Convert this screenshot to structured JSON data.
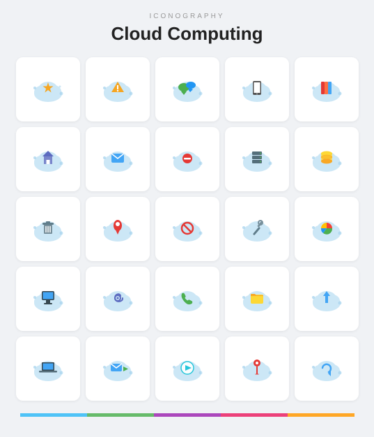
{
  "header": {
    "subtitle": "Iconography",
    "title": "Cloud Computing"
  },
  "icons": [
    {
      "name": "cloud-star",
      "desc": "Cloud with star"
    },
    {
      "name": "cloud-warning",
      "desc": "Cloud with warning"
    },
    {
      "name": "cloud-chat",
      "desc": "Cloud with chat"
    },
    {
      "name": "cloud-mobile",
      "desc": "Cloud with mobile"
    },
    {
      "name": "cloud-book",
      "desc": "Cloud with book"
    },
    {
      "name": "cloud-home",
      "desc": "Cloud with home"
    },
    {
      "name": "cloud-mail",
      "desc": "Cloud with mail"
    },
    {
      "name": "cloud-minus",
      "desc": "Cloud with minus"
    },
    {
      "name": "cloud-server",
      "desc": "Cloud with server"
    },
    {
      "name": "cloud-database",
      "desc": "Cloud with database"
    },
    {
      "name": "cloud-trash",
      "desc": "Cloud with trash"
    },
    {
      "name": "cloud-location",
      "desc": "Cloud with location"
    },
    {
      "name": "cloud-block",
      "desc": "Cloud with block"
    },
    {
      "name": "cloud-settings",
      "desc": "Cloud with settings"
    },
    {
      "name": "cloud-chart",
      "desc": "Cloud with chart"
    },
    {
      "name": "cloud-monitor",
      "desc": "Cloud with monitor"
    },
    {
      "name": "cloud-at",
      "desc": "Cloud with at sign"
    },
    {
      "name": "cloud-phone",
      "desc": "Cloud with phone"
    },
    {
      "name": "cloud-folder",
      "desc": "Cloud with folder"
    },
    {
      "name": "cloud-upload",
      "desc": "Cloud with upload"
    },
    {
      "name": "cloud-laptop",
      "desc": "Cloud with laptop"
    },
    {
      "name": "cloud-email",
      "desc": "Cloud with email arrow"
    },
    {
      "name": "cloud-music",
      "desc": "Cloud with music"
    },
    {
      "name": "cloud-pin",
      "desc": "Cloud with pin"
    },
    {
      "name": "cloud-refresh",
      "desc": "Cloud with refresh"
    }
  ],
  "colorBars": [
    {
      "color": "#4fc3f7",
      "name": "blue"
    },
    {
      "color": "#66bb6a",
      "name": "green"
    },
    {
      "color": "#ab47bc",
      "name": "purple"
    },
    {
      "color": "#ec407a",
      "name": "pink"
    },
    {
      "color": "#ffa726",
      "name": "orange"
    }
  ]
}
